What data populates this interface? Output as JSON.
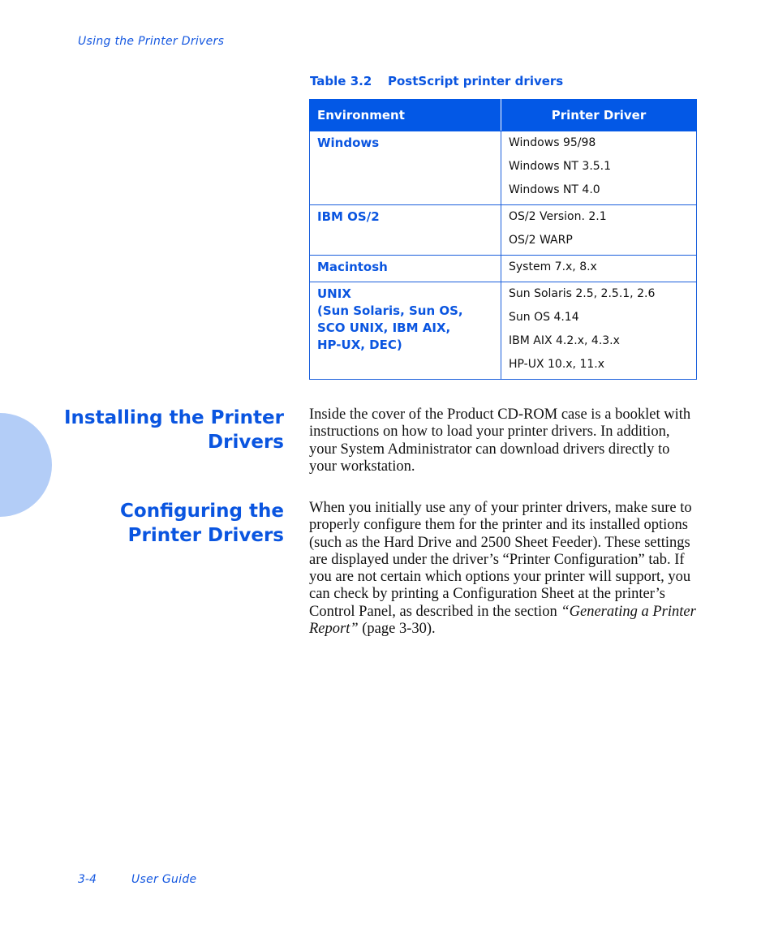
{
  "page": {
    "running_header": "Using the Printer Drivers",
    "footer": {
      "page_number": "3-4",
      "title": "User Guide"
    }
  },
  "table": {
    "caption_number": "Table 3.2",
    "caption_title": "PostScript printer drivers",
    "headers": [
      "Environment",
      "Printer Driver"
    ],
    "rows": [
      {
        "environment": "Windows",
        "drivers": [
          "Windows 95/98",
          "Windows NT 3.5.1",
          "Windows NT 4.0"
        ]
      },
      {
        "environment": "IBM OS/2",
        "drivers": [
          "OS/2 Version. 2.1",
          "OS/2 WARP"
        ]
      },
      {
        "environment": "Macintosh",
        "drivers": [
          "System 7.x, 8.x"
        ]
      },
      {
        "environment": "UNIX\n(Sun Solaris, Sun OS,\nSCO UNIX, IBM AIX,\nHP-UX, DEC)",
        "drivers": [
          "Sun Solaris 2.5, 2.5.1, 2.6",
          "Sun OS 4.14",
          "IBM AIX 4.2.x, 4.3.x",
          "HP-UX 10.x, 11.x"
        ]
      }
    ]
  },
  "sections": [
    {
      "heading_line1": "Installing the Printer",
      "heading_line2": "Drivers",
      "body": "Inside the cover of the Product CD-ROM case is a booklet with instructions on how to load your printer drivers. In addition, your System Administrator can download drivers directly to your workstation."
    },
    {
      "heading_line1": "Configuring the",
      "heading_line2": "Printer Drivers",
      "body_before": "When you initially use any of your printer drivers, make sure to properly configure them for the printer and its installed options (such as the Hard Drive and 2500 Sheet Feeder). These settings are displayed under the driver’s “Printer Configuration” tab. If you are not certain which options your printer will support, you can check by printing a Configuration Sheet at the printer’s Control Panel, as described in the section ",
      "body_italic": "“Generating a Printer Report”",
      "body_after": " (page 3-30)."
    }
  ],
  "colors": {
    "accent": "#0358e6",
    "side_tab": "#b3cdf7",
    "text": "#111111"
  }
}
